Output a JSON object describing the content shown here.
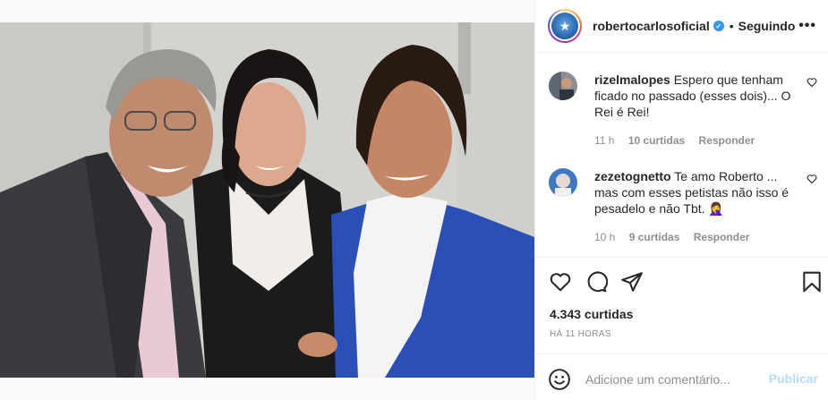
{
  "post": {
    "username": "robertocarlosoficial",
    "separator": "•",
    "following_label": "Seguindo",
    "more_label": "•••",
    "likes": "4.343 curtidas",
    "time": "HÁ 11 HORAS"
  },
  "comments": [
    {
      "user": "rizelmalopes",
      "text": "Espero que tenham ficado no passado (esses dois)... O Rei é Rei!",
      "age": "11 h",
      "likes": "10 curtidas",
      "reply": "Responder"
    },
    {
      "user": "zezetognetto",
      "text": "Te amo Roberto ... mas com esses petistas não isso é pesadelo e não Tbt. 🤦‍♀️",
      "age": "10 h",
      "likes": "9 curtidas",
      "reply": "Responder"
    }
  ],
  "composer": {
    "placeholder": "Adicione um comentário...",
    "publish": "Publicar"
  },
  "icons": {
    "like": "heart-icon",
    "comment": "comment-icon",
    "share": "share-icon",
    "save": "bookmark-icon",
    "emoji": "emoji-icon",
    "options": "more-icon"
  },
  "colors": {
    "verified": "#3897f0",
    "publish_disabled": "#b3dbff",
    "muted_text": "#8e8e8e",
    "border": "#efefef"
  }
}
